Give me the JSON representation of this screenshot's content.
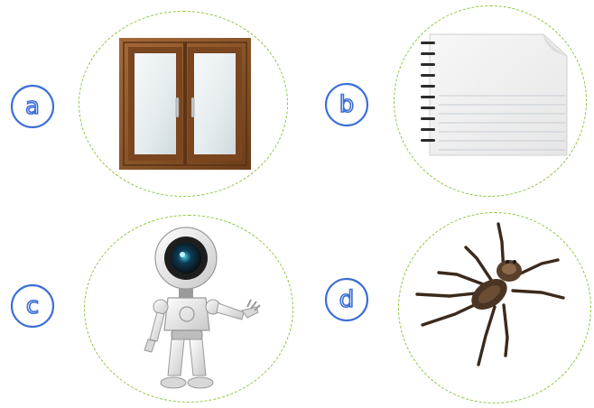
{
  "items": [
    {
      "label": "a",
      "picture": "window-icon"
    },
    {
      "label": "b",
      "picture": "notepad-icon"
    },
    {
      "label": "c",
      "picture": "robot-icon"
    },
    {
      "label": "d",
      "picture": "spider-icon"
    }
  ],
  "colors": {
    "badge_stroke": "#3d6fd6",
    "ring_dash": "#8dc63f",
    "wood": "#8a5528",
    "glass": "#e8eef0"
  }
}
